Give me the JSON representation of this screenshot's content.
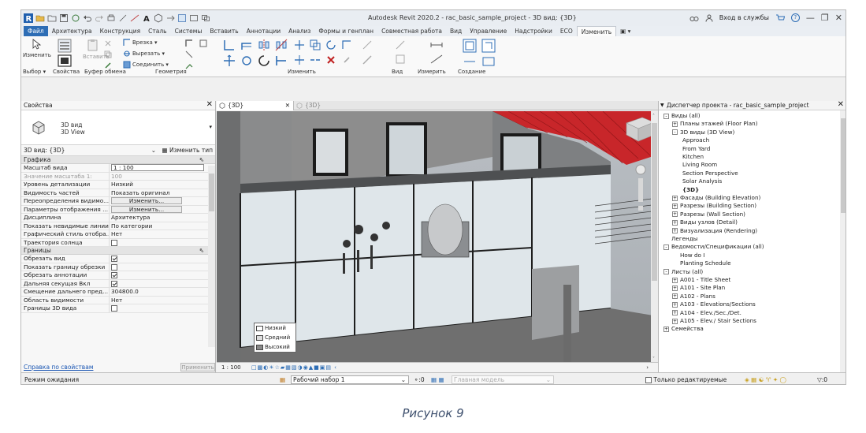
{
  "window": {
    "title": "Autodesk Revit 2020.2 - rac_basic_sample_project - 3D вид: {3D}",
    "signin": "Вход в службы",
    "help": "?"
  },
  "tabs": [
    "Файл",
    "Архитектура",
    "Конструкция",
    "Сталь",
    "Системы",
    "Вставить",
    "Аннотации",
    "Анализ",
    "Формы и генплан",
    "Совместная работа",
    "Вид",
    "Управление",
    "Надстройки",
    "ECO",
    "Изменить"
  ],
  "ribbon": {
    "modify_label": "Изменить",
    "paste_label": "Вставить",
    "cut": "Врезка",
    "cutout": "Вырезать",
    "join": "Соединить",
    "groups": [
      "Выбор",
      "Свойства",
      "Буфер обмена",
      "Геометрия",
      "Изменить",
      "Вид",
      "Измерить",
      "Создание"
    ]
  },
  "properties": {
    "title": "Свойства",
    "type_name_line1": "3D вид",
    "type_name_line2": "3D View",
    "selector": "3D вид: {3D}",
    "edit_type": "Изменить тип",
    "section_graphics": "Графика",
    "rows_graphics": [
      {
        "k": "Масштаб вида",
        "v": "1 : 100",
        "kind": "input"
      },
      {
        "k": "Значение масштаба 1:",
        "v": "100",
        "kind": "dim"
      },
      {
        "k": "Уровень детализации",
        "v": "Низкий",
        "kind": "text"
      },
      {
        "k": "Видимость частей",
        "v": "Показать оригинал",
        "kind": "text"
      },
      {
        "k": "Переопределения видимо...",
        "v": "Изменить...",
        "kind": "button"
      },
      {
        "k": "Параметры отображения ...",
        "v": "Изменить...",
        "kind": "button"
      },
      {
        "k": "Дисциплина",
        "v": "Архитектура",
        "kind": "text"
      },
      {
        "k": "Показать невидимые линии",
        "v": "По категории",
        "kind": "text"
      },
      {
        "k": "Графический стиль отобра...",
        "v": "Нет",
        "kind": "text"
      },
      {
        "k": "Траектория солнца",
        "v": "",
        "kind": "cb-off"
      }
    ],
    "section_bounds": "Границы",
    "rows_bounds": [
      {
        "k": "Обрезать вид",
        "v": "",
        "kind": "cb-on"
      },
      {
        "k": "Показать границу обрезки",
        "v": "",
        "kind": "cb-off"
      },
      {
        "k": "Обрезать аннотации",
        "v": "",
        "kind": "cb-on"
      },
      {
        "k": "Дальняя секущая Вкл",
        "v": "",
        "kind": "cb-on"
      },
      {
        "k": "Смещение дальнего пред...",
        "v": "304800.0",
        "kind": "text"
      },
      {
        "k": "Область видимости",
        "v": "Нет",
        "kind": "text"
      },
      {
        "k": "Границы 3D вида",
        "v": "",
        "kind": "cb-off"
      }
    ],
    "help_link": "Справка по свойствам",
    "apply": "Применить"
  },
  "view": {
    "tab_active": "{3D}",
    "tab_other": "{3D}",
    "scale": "1 : 100",
    "detail_options": [
      "Низкий",
      "Средний",
      "Высокий"
    ]
  },
  "browser": {
    "title": "Диспетчер проекта - rac_basic_sample_project",
    "nodes": [
      {
        "t": "Виды (all)",
        "lvl": 0,
        "tog": "-"
      },
      {
        "t": "Планы этажей (Floor Plan)",
        "lvl": 1,
        "tog": "+"
      },
      {
        "t": "3D виды (3D View)",
        "lvl": 1,
        "tog": "-"
      },
      {
        "t": "Approach",
        "lvl": 2,
        "tog": ""
      },
      {
        "t": "From Yard",
        "lvl": 2,
        "tog": ""
      },
      {
        "t": "Kitchen",
        "lvl": 2,
        "tog": ""
      },
      {
        "t": "Living Room",
        "lvl": 2,
        "tog": ""
      },
      {
        "t": "Section Perspective",
        "lvl": 2,
        "tog": ""
      },
      {
        "t": "Solar Analysis",
        "lvl": 2,
        "tog": ""
      },
      {
        "t": "{3D}",
        "lvl": 2,
        "tog": "",
        "bold": true
      },
      {
        "t": "Фасады (Building Elevation)",
        "lvl": 1,
        "tog": "+"
      },
      {
        "t": "Разрезы (Building Section)",
        "lvl": 1,
        "tog": "+"
      },
      {
        "t": "Разрезы (Wall Section)",
        "lvl": 1,
        "tog": "+"
      },
      {
        "t": "Виды узлов (Detail)",
        "lvl": 1,
        "tog": "+"
      },
      {
        "t": "Визуализация (Rendering)",
        "lvl": 1,
        "tog": "+"
      },
      {
        "t": "Легенды",
        "lvl": 0,
        "tog": ""
      },
      {
        "t": "Ведомости/Спецификации (all)",
        "lvl": 0,
        "tog": "-"
      },
      {
        "t": "How do I",
        "lvl": 1,
        "tog": ""
      },
      {
        "t": "Planting Schedule",
        "lvl": 1,
        "tog": ""
      },
      {
        "t": "Листы (all)",
        "lvl": 0,
        "tog": "-"
      },
      {
        "t": "A001 - Title Sheet",
        "lvl": 1,
        "tog": "+"
      },
      {
        "t": "A101 - Site Plan",
        "lvl": 1,
        "tog": "+"
      },
      {
        "t": "A102 - Plans",
        "lvl": 1,
        "tog": "+"
      },
      {
        "t": "A103 - Elevations/Sections",
        "lvl": 1,
        "tog": "+"
      },
      {
        "t": "A104 - Elev./Sec./Det.",
        "lvl": 1,
        "tog": "+"
      },
      {
        "t": "A105 - Elev./ Stair Sections",
        "lvl": 1,
        "tog": "+"
      },
      {
        "t": "Семейства",
        "lvl": 0,
        "tog": "+"
      }
    ]
  },
  "status": {
    "text": "Режим ожидания",
    "workset": "Рабочий набор 1",
    "zero": ":0",
    "model": "Главная модель",
    "editable_only": "Только редактируемые",
    "filter_count": ":0"
  },
  "caption": "Рисунок 9"
}
